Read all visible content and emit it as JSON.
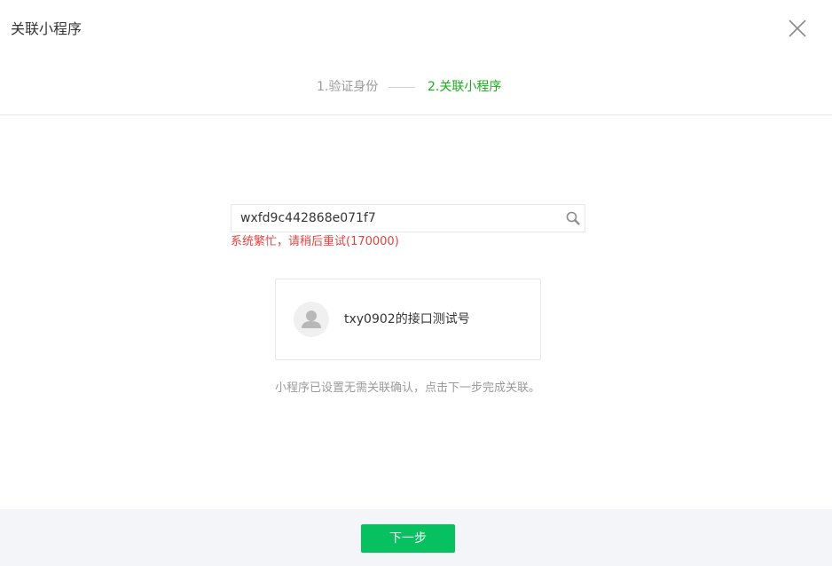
{
  "dialog": {
    "title": "关联小程序",
    "close_icon": "close-icon"
  },
  "steps": [
    {
      "label": "1.验证身份",
      "state": "done"
    },
    {
      "label": "2.关联小程序",
      "state": "active"
    }
  ],
  "search": {
    "value": "wxfd9c442868e071f7",
    "icon": "search-icon"
  },
  "error": {
    "message": "系统繁忙，请稍后重试(170000)"
  },
  "account": {
    "name": "txy0902的接口测试号",
    "avatar_icon": "default-avatar-icon"
  },
  "tip": "小程序已设置无需关联确认，点击下一步完成关联。",
  "footer": {
    "next_label": "下一步"
  },
  "colors": {
    "accent": "#1aad19",
    "button": "#07c160",
    "error": "#e64340",
    "muted": "#9a9a9a"
  }
}
